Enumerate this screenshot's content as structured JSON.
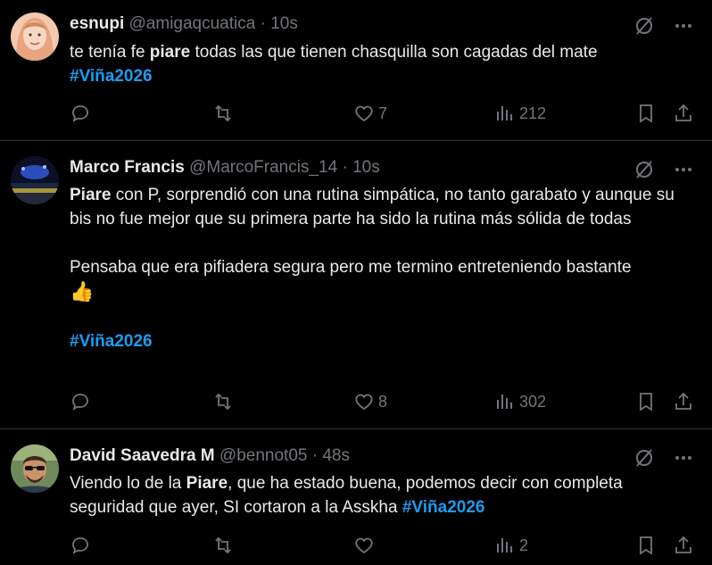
{
  "tweets": [
    {
      "name": "esnupi",
      "handle": "@amigaqcuatica",
      "dot": "·",
      "time": "10s",
      "text_before": "te tenía fe ",
      "highlight": "piare",
      "text_after": " todas las que tienen chasquilla son cagadas del mate",
      "hashtag": "#Viña2026",
      "likes": "7",
      "views": "212"
    },
    {
      "name": "Marco Francis",
      "handle": "@MarcoFrancis_14",
      "dot": "·",
      "time": "10s",
      "highlight": "Piare",
      "text_p1_after": " con P, sorprendió con una rutina simpática, no tanto garabato y aunque su bis no fue mejor que su primera parte ha sido la rutina más sólida de todas",
      "text_p2": "Pensaba que era pifiadera segura pero me termino entreteniendo bastante",
      "emoji": "👍",
      "hashtag": "#Viña2026",
      "likes": "8",
      "views": "302"
    },
    {
      "name": "David Saavedra M",
      "handle": "@bennot05",
      "dot": "·",
      "time": "48s",
      "text_before": "Viendo lo de la ",
      "highlight": "Piare",
      "text_after": ", que ha estado buena,  podemos decir con completa seguridad que ayer, SI cortaron a la Asskha ",
      "hashtag": "#Viña2026",
      "likes": "",
      "views": "2"
    }
  ],
  "icons": {
    "reply": "reply-icon",
    "repost": "repost-icon",
    "like": "heart-icon",
    "views": "views-icon",
    "bookmark": "bookmark-icon",
    "share": "share-icon",
    "grok": "grok-icon",
    "more": "more-icon"
  },
  "colors": {
    "hashtag": "#1d9bf0",
    "muted": "#71767b",
    "background": "#000000",
    "divider": "#2f3336"
  }
}
